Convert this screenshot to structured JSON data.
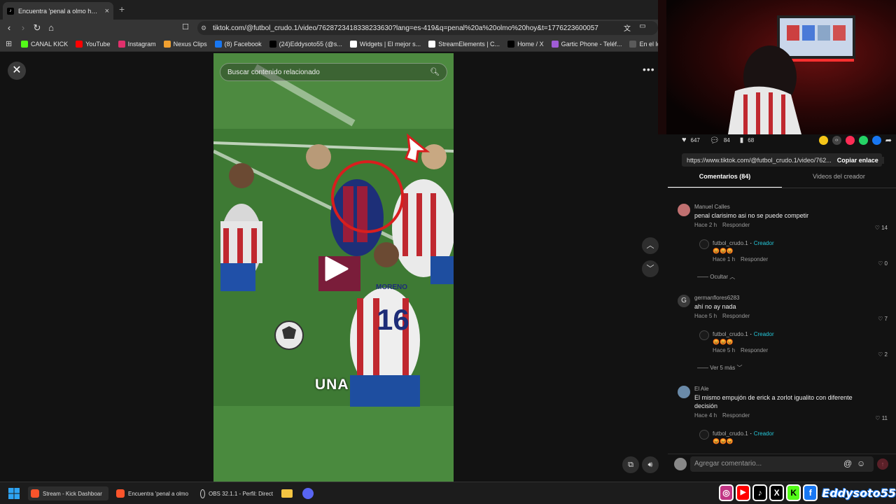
{
  "browser": {
    "tab_title": "Encuentra 'penal a olmo hoy' en",
    "url": "tiktok.com/@futbol_crudo.1/video/7628723418338233630?lang=es-419&q=penal%20a%20olmo%20hoy&t=1776223600057",
    "bookmarks": [
      {
        "label": "CANAL KICK",
        "icon": "kick-icon",
        "color": "#53fc18"
      },
      {
        "label": "YouTube",
        "icon": "youtube-icon",
        "color": "#ff0000"
      },
      {
        "label": "Instagram",
        "icon": "instagram-icon",
        "color": "#e1306c"
      },
      {
        "label": "Nexus Clips",
        "icon": "nexus-icon",
        "color": "#f0a030"
      },
      {
        "label": "(8) Facebook",
        "icon": "facebook-icon",
        "color": "#1877f2"
      },
      {
        "label": "(24)Eddysoto55 (@s...",
        "icon": "tiktok-icon",
        "color": "#000000"
      },
      {
        "label": "Widgets | El mejor s...",
        "icon": "widget-icon",
        "color": "#ffffff"
      },
      {
        "label": "StreamElements | C...",
        "icon": "streamelements-icon",
        "color": "#ffffff"
      },
      {
        "label": "Home / X",
        "icon": "x-icon",
        "color": "#000000"
      },
      {
        "label": "Gartic Phone - Teléf...",
        "icon": "gartic-icon",
        "color": "#a05cd6"
      },
      {
        "label": "En el lobby - Make i...",
        "icon": "lobby-icon",
        "color": "#5a5a5a"
      }
    ]
  },
  "video": {
    "search_placeholder": "Buscar contenido relacionado",
    "caption": "UNA",
    "jersey_number": "16",
    "jersey_name": "MORENO"
  },
  "actions": {
    "likes": "647",
    "comments": "84",
    "saves": "68"
  },
  "share": {
    "link": "https://www.tiktok.com/@futbol_crudo.1/video/762...",
    "copy_label": "Copiar enlace"
  },
  "tabs": {
    "comments": "Comentarios (84)",
    "creator_videos": "Videos del creador"
  },
  "comments": [
    {
      "user": "Manuel Calles",
      "text": "penal clarisimo asi no se puede competir",
      "time": "Hace 2 h",
      "reply": "Responder",
      "likes": "14",
      "creator_reply": {
        "user": "futbol_crudo.1",
        "badge": "Creador",
        "emoji": "😡😡😡",
        "time": "Hace 1 h",
        "reply": "Responder",
        "likes": "0"
      },
      "toggle": "Ocultar"
    },
    {
      "user": "germanflores6283",
      "avatar_letter": "G",
      "text": "ahí no ay nada",
      "time": "Hace 5 h",
      "reply": "Responder",
      "likes": "7",
      "creator_reply": {
        "user": "futbol_crudo.1",
        "badge": "Creador",
        "emoji": "😡😡😡",
        "time": "Hace 5 h",
        "reply": "Responder",
        "likes": "2"
      },
      "toggle": "Ver 5 más"
    },
    {
      "user": "El Ale",
      "text": "El mismo empujón de erick a zorlot igualito con diferente decisión",
      "time": "Hace 4 h",
      "reply": "Responder",
      "likes": "11",
      "creator_reply": {
        "user": "futbol_crudo.1",
        "badge": "Creador",
        "emoji": "😡😡😡"
      }
    }
  ],
  "comment_input": {
    "placeholder": "Agregar comentario..."
  },
  "taskbar": {
    "items": [
      {
        "label": "Stream - Kick Dashboar",
        "icon": "brave-icon"
      },
      {
        "label": "Encuentra 'penal a olmo",
        "icon": "brave-icon"
      },
      {
        "label": "OBS 32.1.1 - Perfil: Direct",
        "icon": "obs-icon"
      }
    ]
  },
  "overlay": {
    "channel_name": "Eddysoto55"
  }
}
